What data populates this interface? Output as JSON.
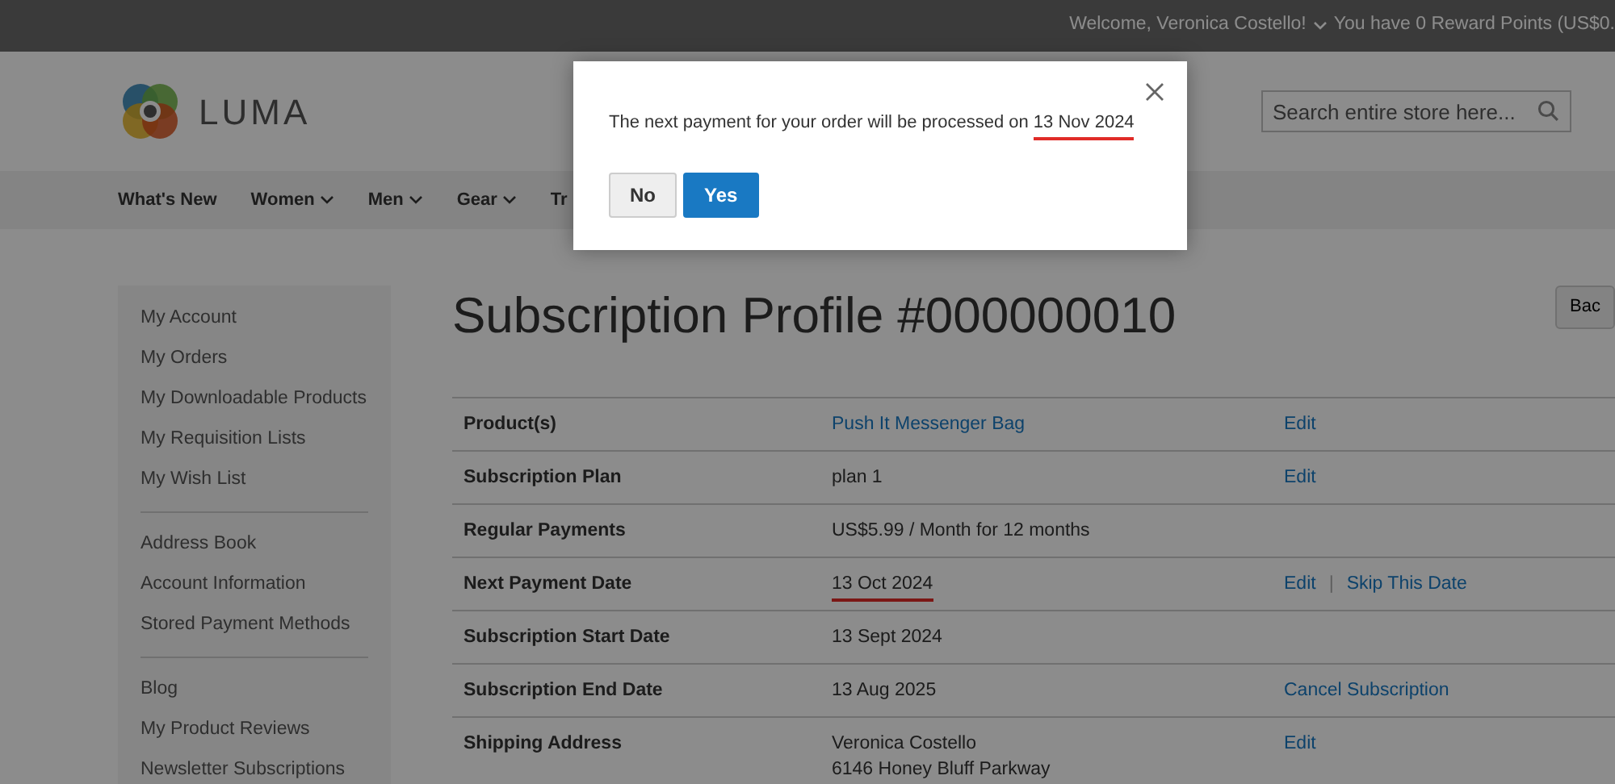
{
  "top_bar": {
    "welcome": "Welcome, Veronica Costello!",
    "rewards": "You have 0 Reward Points (US$0."
  },
  "header": {
    "logo_text": "LUMA",
    "search": {
      "placeholder": "Search entire store here..."
    }
  },
  "nav": [
    {
      "label": "What's New",
      "dropdown": false
    },
    {
      "label": "Women",
      "dropdown": true
    },
    {
      "label": "Men",
      "dropdown": true
    },
    {
      "label": "Gear",
      "dropdown": true
    },
    {
      "label": "Tr",
      "dropdown": false
    }
  ],
  "sidebar": {
    "groups": [
      [
        "My Account",
        "My Orders",
        "My Downloadable Products",
        "My Requisition Lists",
        "My Wish List"
      ],
      [
        "Address Book",
        "Account Information",
        "Stored Payment Methods"
      ],
      [
        "Blog",
        "My Product Reviews",
        "Newsletter Subscriptions"
      ]
    ]
  },
  "page_title": "Subscription Profile #000000010",
  "back_button": "Bac",
  "table": {
    "action_separator": "|",
    "rows": [
      {
        "label": "Product(s)",
        "value": [
          "Push It Messenger Bag"
        ],
        "kind": "link",
        "highlighted": false,
        "actions": [
          "Edit"
        ]
      },
      {
        "label": "Subscription Plan",
        "value": [
          "plan 1"
        ],
        "kind": "text",
        "highlighted": false,
        "actions": [
          "Edit"
        ]
      },
      {
        "label": "Regular Payments",
        "value": [
          "US$5.99 / Month for 12 months"
        ],
        "kind": "text",
        "highlighted": false,
        "actions": []
      },
      {
        "label": "Next Payment Date",
        "value": [
          "13 Oct 2024"
        ],
        "kind": "text",
        "highlighted": true,
        "actions": [
          "Edit",
          "Skip This Date"
        ]
      },
      {
        "label": "Subscription Start Date",
        "value": [
          "13 Sept 2024"
        ],
        "kind": "text",
        "highlighted": false,
        "actions": []
      },
      {
        "label": "Subscription End Date",
        "value": [
          "13 Aug 2025"
        ],
        "kind": "text",
        "highlighted": false,
        "actions": [
          "Cancel Subscription"
        ]
      },
      {
        "label": "Shipping Address",
        "value": [
          "Veronica Costello",
          "6146 Honey Bluff Parkway"
        ],
        "kind": "text",
        "highlighted": false,
        "actions": [
          "Edit"
        ]
      }
    ]
  },
  "modal": {
    "message": "The next payment for your order will be processed on",
    "date": "13 Nov 2024",
    "date_highlighted": true,
    "buttons": [
      {
        "label": "No",
        "kind": "secondary"
      },
      {
        "label": "Yes",
        "kind": "primary"
      }
    ]
  }
}
